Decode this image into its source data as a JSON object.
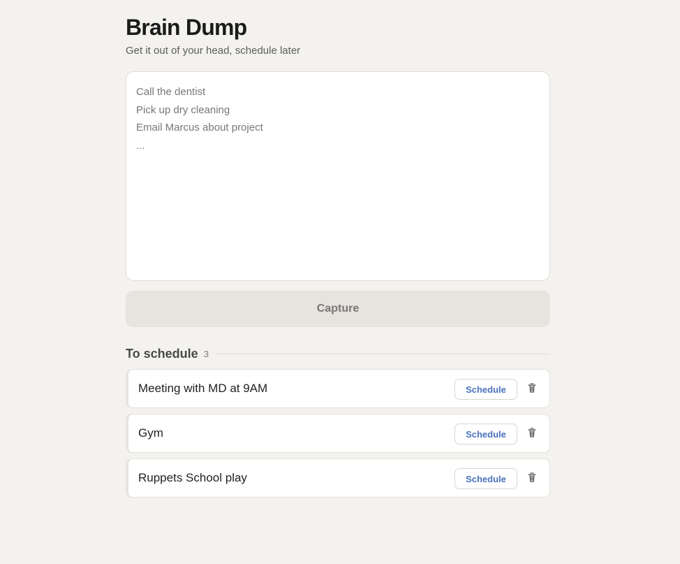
{
  "header": {
    "title": "Brain Dump",
    "subtitle": "Get it out of your head, schedule later"
  },
  "dump_input": {
    "value": "",
    "placeholder_lines": [
      "Call the dentist",
      "Pick up dry cleaning",
      "Email Marcus about project",
      "..."
    ]
  },
  "actions": {
    "capture_label": "Capture"
  },
  "schedule_section": {
    "title": "To schedule",
    "count": "3",
    "items": [
      {
        "label": "Meeting with MD at 9AM",
        "schedule_label": "Schedule",
        "delete_icon": "trash-icon"
      },
      {
        "label": "Gym",
        "schedule_label": "Schedule",
        "delete_icon": "trash-icon"
      },
      {
        "label": "Ruppets School play",
        "schedule_label": "Schedule",
        "delete_icon": "trash-icon"
      }
    ]
  },
  "colors": {
    "background": "#f3f2ee",
    "card": "#ffffff",
    "muted_button": "#e6e4df",
    "accent_blue": "#4b72bd"
  }
}
